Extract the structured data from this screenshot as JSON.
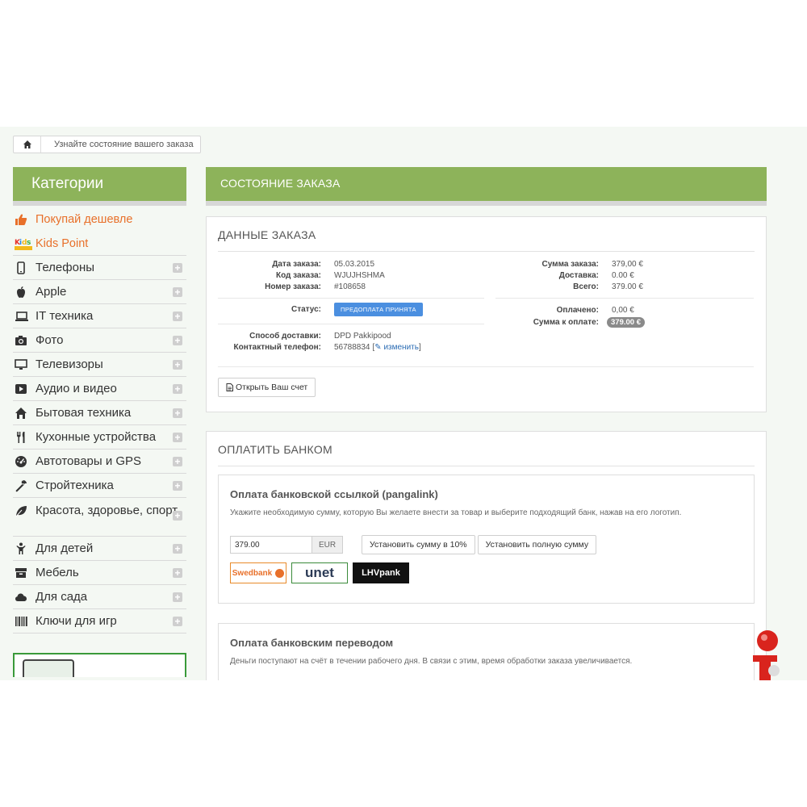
{
  "breadcrumb": {
    "text": "Узнайте состояние вашего заказа"
  },
  "sidebar": {
    "title": "Категории",
    "promos": [
      {
        "label": "Покупай дешевле",
        "icon": "thumbs-up-icon"
      },
      {
        "label": "Kids Point",
        "icon": "kids-point-logo"
      }
    ],
    "items": [
      {
        "label": "Телефоны",
        "icon": "phone-icon"
      },
      {
        "label": "Apple",
        "icon": "apple-icon"
      },
      {
        "label": "IT техника",
        "icon": "laptop-icon"
      },
      {
        "label": "Фото",
        "icon": "camera-icon"
      },
      {
        "label": "Телевизоры",
        "icon": "monitor-icon"
      },
      {
        "label": "Аудио и видео",
        "icon": "play-icon"
      },
      {
        "label": "Бытовая техника",
        "icon": "home-icon"
      },
      {
        "label": "Кухонные устройства",
        "icon": "cutlery-icon"
      },
      {
        "label": "Автотовары и GPS",
        "icon": "dashboard-icon"
      },
      {
        "label": "Стройтехника",
        "icon": "wrench-icon"
      },
      {
        "label": "Красота, здоровье, спорт",
        "icon": "leaf-icon"
      },
      {
        "label": "Для детей",
        "icon": "child-icon"
      },
      {
        "label": "Мебель",
        "icon": "archive-icon"
      },
      {
        "label": "Для сада",
        "icon": "cloud-icon"
      },
      {
        "label": "Ключи для игр",
        "icon": "barcode-icon"
      }
    ]
  },
  "main": {
    "title": "СОСТОЯНИЕ ЗАКАЗА",
    "order": {
      "title": "ДАННЫЕ ЗАКАЗА",
      "date_label": "Дата заказа:",
      "date": "05.03.2015",
      "code_label": "Код заказа:",
      "code": "WJUJHSHMA",
      "number_label": "Номер заказа:",
      "number": "#108658",
      "status_label": "Статус:",
      "status": "ПРЕДОПЛАТА ПРИНЯТА",
      "delivery_label": "Способ доставки:",
      "delivery": "DPD Pakkipood",
      "phone_label": "Контактный телефон:",
      "phone": "56788834",
      "change_link": "изменить",
      "sum_label": "Сумма заказа:",
      "sum": "379,00 €",
      "shipping_label": "Доставка:",
      "shipping": "0.00 €",
      "total_label": "Всего:",
      "total": "379.00 €",
      "paid_label": "Оплачено:",
      "paid": "0,00 €",
      "due_label": "Сумма к оплате:",
      "due": "379.00 €",
      "invoice_button": "Открыть Ваш счет"
    },
    "bank": {
      "title": "ОПЛАТИТЬ БАНКОМ",
      "link_title": "Оплата банковской ссылкой (pangalink)",
      "link_text": "Укажите необходимую сумму, которую Вы желаете внести за товар и выберите подходящий банк, нажав на его логотип.",
      "amount": "379.00",
      "currency": "EUR",
      "btn_10": "Установить сумму в 10%",
      "btn_full": "Установить полную сумму",
      "banks": [
        "Swedbank",
        "unet",
        "LHVpank"
      ],
      "transfer_title": "Оплата банковским переводом",
      "transfer_text": "Деньги поступают на счёт в течении рабочего дня. В связи с этим, время обработки заказа увеличивается."
    }
  },
  "colors": {
    "accent": "#8db35a",
    "status": "#4b8fe0",
    "promo": "#e8702a"
  }
}
